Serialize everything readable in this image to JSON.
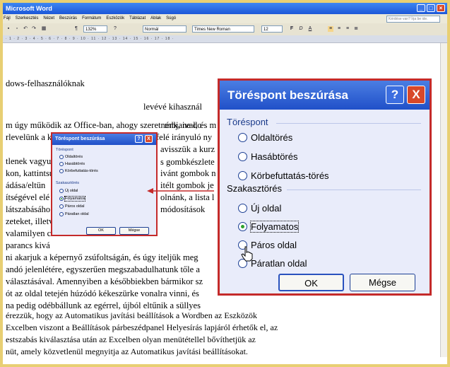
{
  "window": {
    "title": "Microsoft Word"
  },
  "menu": [
    "Fájl",
    "Szerkesztés",
    "Nézet",
    "Beszúrás",
    "Formátum",
    "Eszközök",
    "Táblázat",
    "Ablak",
    "Súgó"
  ],
  "help_box_placeholder": "Kérdése van? Írja be ide.",
  "toolbar": {
    "zoom": "132%",
    "style": "Normál",
    "font": "Times New Roman",
    "size": "12"
  },
  "ruler_text": "· 1 · 2 · 3 · 4 · 5 · 6 · 7 · 8 · 9 · 10 · 11 · 12 · 13 · 14 · 15 · 16 · 17 · 18 ·",
  "document_lines": [
    "dows-felhasználóknak",
    "m úgy működik az Office-ban, ahogy szeretnénk, ne do",
    "rlevelünk a k",
    "tlenek vagyu",
    "kon, kattintsu",
    "ádása/eltün",
    "ítségével elé",
    "látszabásáho",
    "zeteket, illetv",
    "valamilyen c",
    "parancs kivá",
    "ni akarjuk a képernyő zsúfoltságán, és úgy iteljük meg",
    "andó jelenlétére, egyszerűen megszabadulhatunk tőle a",
    "választásával. Amennyiben a későbbiekben bármikor sz",
    "ót az oldal tetején húzódó kékeszürke vonalra vinni, és",
    "na pedig odébbállunk az egérrel, újból eltűnik a süllyes",
    "érezzük, hogy az Automatikus javítási beállítások a Wordben az Eszközök",
    "Excelben viszont a Beállítások párbeszédpanel Helyesírás lapjáról érhetők el, az",
    "estszabás kiválasztása után az Excelben olyan menütétellel bővíthetjük az",
    "nüt, amely közvetlenül megnyitja az Automatikus javítási beállításokat."
  ],
  "document_fragments": {
    "a": "levévé kihasznál",
    "b": "mbjaival, és m",
    "c": "felé irányuló ny",
    "d": "avisszük a kurz",
    "e": "s gombkészlete",
    "f": "ivánt gombok n",
    "g": "itélt gombok je",
    "h": "olnánk, a lista l",
    "i": "módosítások"
  },
  "dialog": {
    "title": "Töréspont beszúrása",
    "help": "?",
    "close": "X",
    "group1": "Töréspont",
    "options1": [
      "Oldaltörés",
      "Hasábtörés",
      "Körbefuttatás-törés"
    ],
    "group2": "Szakasztörés",
    "options2": [
      "Új oldal",
      "Folyamatos",
      "Páros oldal",
      "Páratlan oldal"
    ],
    "selected": "Folyamatos",
    "ok": "OK",
    "cancel": "Mégse"
  },
  "colors": {
    "title_blue": "#2a5ed6",
    "highlight_red": "#c42a2a",
    "frame_gold": "#e8cf73"
  }
}
